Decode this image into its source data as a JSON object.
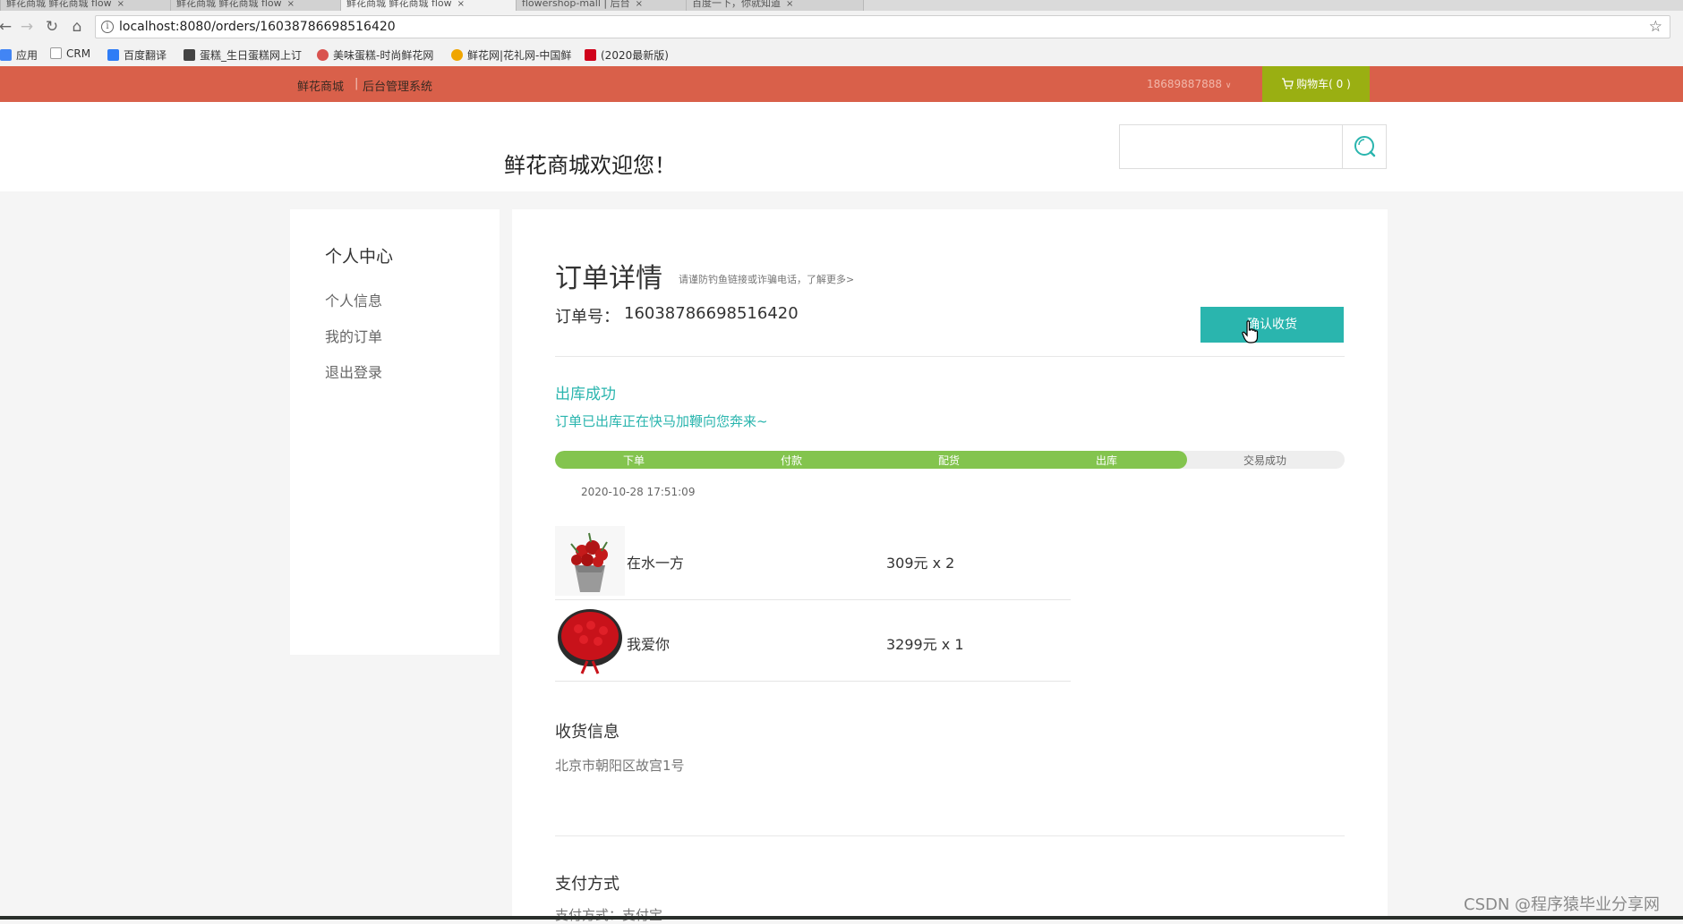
{
  "browser": {
    "tabs": [
      {
        "title": "鲜花商城 鲜花商城 flow"
      },
      {
        "title": "鲜花商城 鲜花商城 flow"
      },
      {
        "title": "鲜花商城 鲜花商城 flow"
      },
      {
        "title": "flowershop-mall | 后台"
      },
      {
        "title": "百度一下，你就知道"
      }
    ],
    "url": "localhost:8080/orders/16038786698516420",
    "bookmarks": [
      {
        "label": "应用",
        "color": "#4285f4"
      },
      {
        "label": "CRM",
        "color": "#999999"
      },
      {
        "label": "百度翻译",
        "color": "#2f7df6"
      },
      {
        "label": "蛋糕_生日蛋糕网上订",
        "color": "#444444"
      },
      {
        "label": "美味蛋糕-时尚鲜花网",
        "color": "#d9534f"
      },
      {
        "label": "鲜花网|花礼网-中国鲜",
        "color": "#f0a500"
      },
      {
        "label": "(2020最新版)",
        "color": "#d0021b"
      }
    ]
  },
  "site": {
    "brand": "鲜花商城",
    "separator": "|",
    "admin_link": "后台管理系统",
    "user": "18689887888",
    "cart_label": "购物车( 0 )",
    "welcome": "鲜花商城欢迎您！",
    "search_placeholder": ""
  },
  "sidebar": {
    "title": "个人中心",
    "items": [
      {
        "label": "个人信息"
      },
      {
        "label": "我的订单"
      },
      {
        "label": "退出登录"
      }
    ]
  },
  "order": {
    "heading": "订单详情",
    "notice": "请谨防钓鱼链接或诈骗电话，了解更多>",
    "number_label": "订单号：",
    "number": "16038786698516420",
    "confirm_button": "确认收货",
    "status_title": "出库成功",
    "status_desc": "订单已出库正在快马加鞭向您奔来~",
    "progress": {
      "steps": [
        "下单",
        "付款",
        "配货",
        "出库",
        "交易成功"
      ],
      "completed": 4
    },
    "timestamp": "2020-10-28 17:51:09",
    "items": [
      {
        "name": "在水一方",
        "price": "309元 x 2",
        "image_icon": "bouquet-vase-icon"
      },
      {
        "name": "我爱你",
        "price": "3299元 x 1",
        "image_icon": "rose-bouquet-icon"
      }
    ],
    "shipping_title": "收货信息",
    "shipping_address": "北京市朝阳区故宫1号",
    "payment_title": "支付方式",
    "payment_method": "支付方式：支付宝"
  },
  "watermark": "CSDN @程序猿毕业分享网",
  "colors": {
    "topbar": "#d9604a",
    "cart": "#9aaf12",
    "accent": "#2ab5ae",
    "progress_done": "#83c44e"
  }
}
